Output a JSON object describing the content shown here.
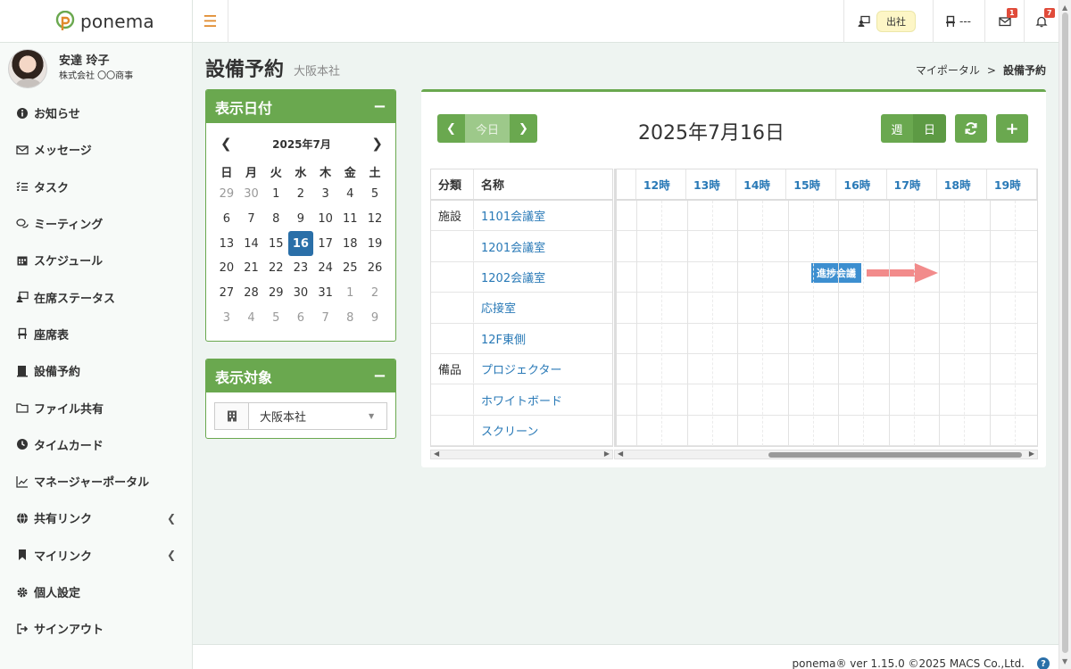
{
  "brand": {
    "name": "ponema"
  },
  "user": {
    "name": "安達 玲子",
    "company": "株式会社 〇〇商事"
  },
  "sidebar": {
    "items": [
      {
        "label": "お知らせ",
        "icon": "info-icon"
      },
      {
        "label": "メッセージ",
        "icon": "mail-icon"
      },
      {
        "label": "タスク",
        "icon": "tasks-icon"
      },
      {
        "label": "ミーティング",
        "icon": "chat-icon"
      },
      {
        "label": "スケジュール",
        "icon": "calendar-icon"
      },
      {
        "label": "在席ステータス",
        "icon": "presence-icon"
      },
      {
        "label": "座席表",
        "icon": "chair-icon"
      },
      {
        "label": "設備予約",
        "icon": "facility-icon"
      },
      {
        "label": "ファイル共有",
        "icon": "folder-icon"
      },
      {
        "label": "タイムカード",
        "icon": "clock-icon"
      },
      {
        "label": "マネージャーポータル",
        "icon": "chart-icon"
      },
      {
        "label": "共有リンク",
        "icon": "globe-icon"
      },
      {
        "label": "マイリンク",
        "icon": "bookmark-icon"
      },
      {
        "label": "個人設定",
        "icon": "gear-icon"
      },
      {
        "label": "サインアウト",
        "icon": "signout-icon"
      }
    ]
  },
  "topbar": {
    "status_label": "出社",
    "seat_label": "---",
    "mail_badge": "1",
    "bell_badge": "7"
  },
  "page": {
    "title": "設備予約",
    "subtitle": "大阪本社",
    "breadcrumb_home": "マイポータル",
    "breadcrumb_sep": ">",
    "breadcrumb_current": "設備予約"
  },
  "date_panel": {
    "title": "表示日付",
    "collapse": "−",
    "month": "2025年7月",
    "weekdays": [
      "日",
      "月",
      "火",
      "水",
      "木",
      "金",
      "土"
    ],
    "days": [
      [
        "29",
        "30",
        "1",
        "2",
        "3",
        "4",
        "5"
      ],
      [
        "6",
        "7",
        "8",
        "9",
        "10",
        "11",
        "12"
      ],
      [
        "13",
        "14",
        "15",
        "16",
        "17",
        "18",
        "19"
      ],
      [
        "20",
        "21",
        "22",
        "23",
        "24",
        "25",
        "26"
      ],
      [
        "27",
        "28",
        "29",
        "30",
        "31",
        "1",
        "2"
      ],
      [
        "3",
        "4",
        "5",
        "6",
        "7",
        "8",
        "9"
      ]
    ],
    "selected": "16"
  },
  "target_panel": {
    "title": "表示対象",
    "collapse": "−",
    "selected": "大阪本社"
  },
  "schedule": {
    "today_label": "今日",
    "date_title": "2025年7月16日",
    "view_week": "週",
    "view_day": "日",
    "col_category": "分類",
    "col_name": "名称",
    "hours": [
      "12時",
      "13時",
      "14時",
      "15時",
      "16時",
      "17時",
      "18時",
      "19時"
    ],
    "rows": [
      {
        "category": "施設",
        "name": "1101会議室"
      },
      {
        "category": "",
        "name": "1201会議室"
      },
      {
        "category": "",
        "name": "1202会議室"
      },
      {
        "category": "",
        "name": "応接室"
      },
      {
        "category": "",
        "name": "12F東側"
      },
      {
        "category": "備品",
        "name": "プロジェクター"
      },
      {
        "category": "",
        "name": "ホワイトボード"
      },
      {
        "category": "",
        "name": "スクリーン"
      }
    ],
    "event_label": "進捗会議"
  },
  "footer": {
    "text": "ponema® ver 1.15.0 ©2025 MACS Co.,Ltd.",
    "help": "?"
  },
  "colors": {
    "accent": "#6aa84f",
    "selected_day": "#2a6fa8",
    "event": "#3d8fd0",
    "arrow": "#f28b8b"
  }
}
